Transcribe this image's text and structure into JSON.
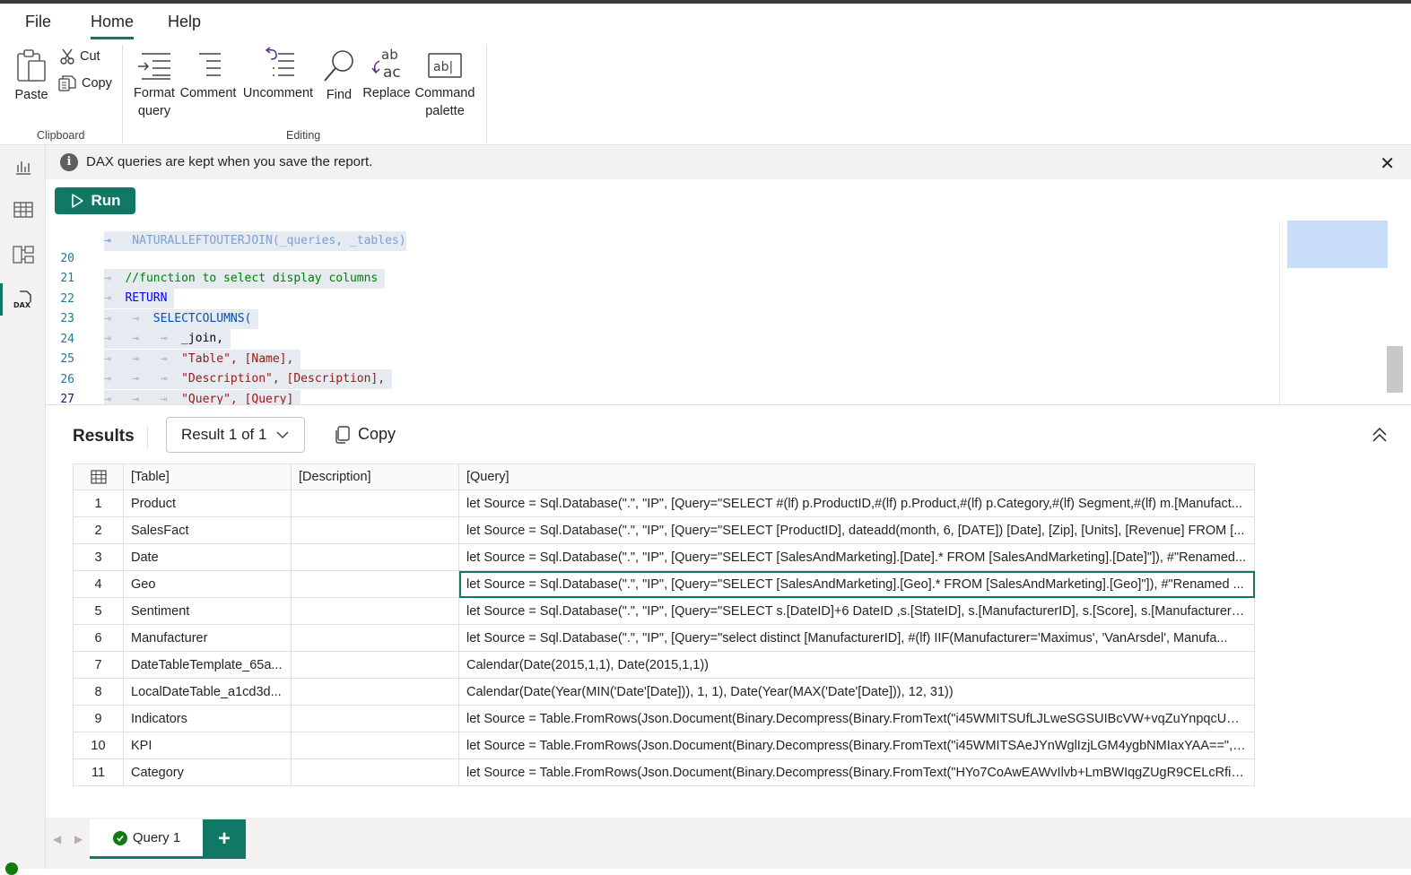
{
  "menu": {
    "file": "File",
    "home": "Home",
    "help": "Help"
  },
  "ribbon": {
    "paste": "Paste",
    "cut": "Cut",
    "copy": "Copy",
    "format_line1": "Format",
    "format_line2": "query",
    "comment": "Comment",
    "uncomment": "Uncomment",
    "find": "Find",
    "replace": "Replace",
    "palette_line1": "Command",
    "palette_line2": "palette",
    "group_clipboard": "Clipboard",
    "group_editing": "Editing"
  },
  "info": {
    "text": "DAX queries are kept when you save the report."
  },
  "run": {
    "label": "Run"
  },
  "editor": {
    "lines": [
      {
        "n": "20",
        "text": "//function to select display columns"
      },
      {
        "n": "21",
        "text": "RETURN"
      },
      {
        "n": "22",
        "text": "SELECTCOLUMNS("
      },
      {
        "n": "23",
        "text": "_join,"
      },
      {
        "n": "24",
        "text": "\"Table\", [Name],"
      },
      {
        "n": "25",
        "text": "\"Description\", [Description],"
      },
      {
        "n": "26",
        "text": "\"Query\", [Query]"
      },
      {
        "n": "27",
        "text": ")"
      }
    ]
  },
  "results": {
    "title": "Results",
    "selector": "Result 1 of 1",
    "copy": "Copy",
    "columns": [
      "[Table]",
      "[Description]",
      "[Query]"
    ],
    "rows": [
      {
        "n": "1",
        "table": "Product",
        "description": "",
        "query": "let Source = Sql.Database(\".\", \"IP\", [Query=\"SELECT #(lf) p.ProductID,#(lf) p.Product,#(lf) p.Category,#(lf) Segment,#(lf) m.[Manufact..."
      },
      {
        "n": "2",
        "table": "SalesFact",
        "description": "",
        "query": "let Source = Sql.Database(\".\", \"IP\", [Query=\"SELECT [ProductID], dateadd(month, 6, [DATE]) [Date], [Zip], [Units], [Revenue] FROM [..."
      },
      {
        "n": "3",
        "table": "Date",
        "description": "",
        "query": "let Source = Sql.Database(\".\", \"IP\", [Query=\"SELECT [SalesAndMarketing].[Date].* FROM [SalesAndMarketing].[Date]\"]), #\"Renamed..."
      },
      {
        "n": "4",
        "table": "Geo",
        "description": "",
        "query": "let Source = Sql.Database(\".\", \"IP\", [Query=\"SELECT [SalesAndMarketing].[Geo].* FROM [SalesAndMarketing].[Geo]\"]), #\"Renamed ..."
      },
      {
        "n": "5",
        "table": "Sentiment",
        "description": "",
        "query": "let Source = Sql.Database(\".\", \"IP\", [Query=\"SELECT s.[DateID]+6 DateID ,s.[StateID], s.[ManufacturerID], s.[Score], s.[Manufacturer], ..."
      },
      {
        "n": "6",
        "table": "Manufacturer",
        "description": "",
        "query": "let Source = Sql.Database(\".\", \"IP\", [Query=\"select distinct [ManufacturerID], #(lf) IIF(Manufacturer='Maximus', 'VanArsdel', Manufa..."
      },
      {
        "n": "7",
        "table": "DateTableTemplate_65a...",
        "description": "",
        "query": "Calendar(Date(2015,1,1), Date(2015,1,1))"
      },
      {
        "n": "8",
        "table": "LocalDateTable_a1cd3d...",
        "description": "",
        "query": "Calendar(Date(Year(MIN('Date'[Date])), 1, 1), Date(Year(MAX('Date'[Date])), 12, 31))"
      },
      {
        "n": "9",
        "table": "Indicators",
        "description": "",
        "query": "let Source = Table.FromRows(Json.Document(Binary.Decompress(Binary.FromText(\"i45WMITSUfLJLweSGSUIBcVW+vqZuYnpqcUZic..."
      },
      {
        "n": "10",
        "table": "KPI",
        "description": "",
        "query": "let Source = Table.FromRows(Json.Document(Binary.Decompress(Binary.FromText(\"i45WMITSAeJYnWglIzjLGM4ygbNMIaxYAA==\", ..."
      },
      {
        "n": "11",
        "table": "Category",
        "description": "",
        "query": "let Source = Table.FromRows(Json.Document(Binary.Decompress(Binary.FromText(\"HYo7CoAwEAWvIlvb+LmBWIqgZUgR9CELcRfiK..."
      }
    ]
  },
  "tabs": {
    "query1": "Query 1",
    "add": "+"
  },
  "colors": {
    "accent": "#117865",
    "success": "#107c10"
  }
}
